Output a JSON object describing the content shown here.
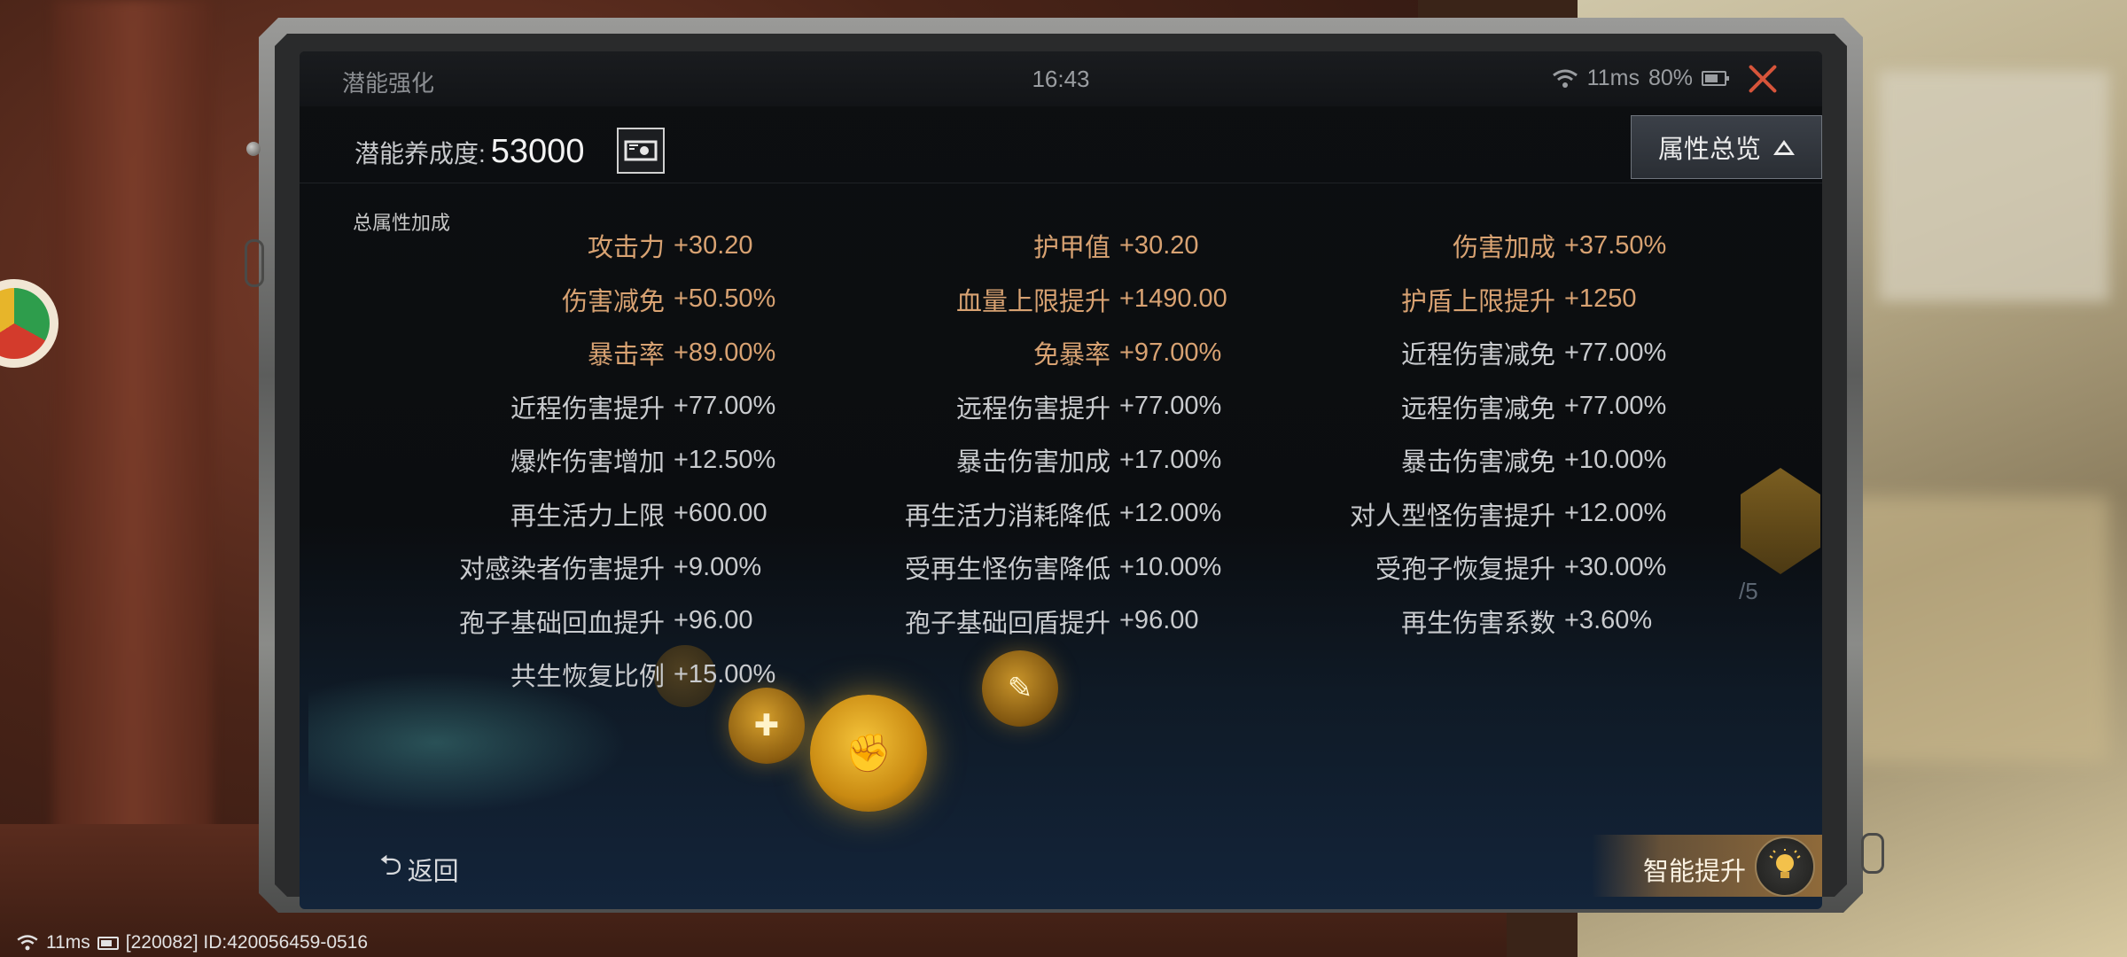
{
  "window": {
    "title": "潜能强化",
    "clock": "16:43",
    "ping": "11ms",
    "battery": "80%"
  },
  "potential": {
    "label": "潜能养成度:",
    "value": "53000"
  },
  "overview_button": "属性总览",
  "section_label": "总属性加成",
  "attributes": [
    {
      "name": "攻击力",
      "value": "+30.20",
      "highlight": true
    },
    {
      "name": "护甲值",
      "value": "+30.20",
      "highlight": true
    },
    {
      "name": "伤害加成",
      "value": "+37.50%",
      "highlight": true
    },
    {
      "name": "伤害减免",
      "value": "+50.50%",
      "highlight": true
    },
    {
      "name": "血量上限提升",
      "value": "+1490.00",
      "highlight": true
    },
    {
      "name": "护盾上限提升",
      "value": "+1250",
      "highlight": true
    },
    {
      "name": "暴击率",
      "value": "+89.00%",
      "highlight": true
    },
    {
      "name": "免暴率",
      "value": "+97.00%",
      "highlight": true
    },
    {
      "name": "近程伤害减免",
      "value": "+77.00%",
      "highlight": false
    },
    {
      "name": "近程伤害提升",
      "value": "+77.00%",
      "highlight": false
    },
    {
      "name": "远程伤害提升",
      "value": "+77.00%",
      "highlight": false
    },
    {
      "name": "远程伤害减免",
      "value": "+77.00%",
      "highlight": false
    },
    {
      "name": "爆炸伤害增加",
      "value": "+12.50%",
      "highlight": false
    },
    {
      "name": "暴击伤害加成",
      "value": "+17.00%",
      "highlight": false
    },
    {
      "name": "暴击伤害减免",
      "value": "+10.00%",
      "highlight": false
    },
    {
      "name": "再生活力上限",
      "value": "+600.00",
      "highlight": false
    },
    {
      "name": "再生活力消耗降低",
      "value": "+12.00%",
      "highlight": false
    },
    {
      "name": "对人型怪伤害提升",
      "value": "+12.00%",
      "highlight": false
    },
    {
      "name": "对感染者伤害提升",
      "value": "+9.00%",
      "highlight": false
    },
    {
      "name": "受再生怪伤害降低",
      "value": "+10.00%",
      "highlight": false
    },
    {
      "name": "受孢子恢复提升",
      "value": "+30.00%",
      "highlight": false
    },
    {
      "name": "孢子基础回血提升",
      "value": "+96.00",
      "highlight": false
    },
    {
      "name": "孢子基础回盾提升",
      "value": "+96.00",
      "highlight": false
    },
    {
      "name": "再生伤害系数",
      "value": "+3.60%",
      "highlight": false
    },
    {
      "name": "共生恢复比例",
      "value": "+15.00%",
      "highlight": false
    }
  ],
  "background_fraction": "/5",
  "back_button": "返回",
  "smart_button": "智能提升",
  "footer": {
    "ping": "11ms",
    "ids": "[220082] ID:420056459-0516"
  },
  "colors": {
    "highlight": "#d8a272",
    "text": "#c9cbce",
    "close": "#d6543a"
  },
  "icons": [
    "wifi-icon",
    "battery-icon",
    "close-icon",
    "cash-icon",
    "triangle-up-icon",
    "back-arrow-icon",
    "bulb-icon"
  ]
}
